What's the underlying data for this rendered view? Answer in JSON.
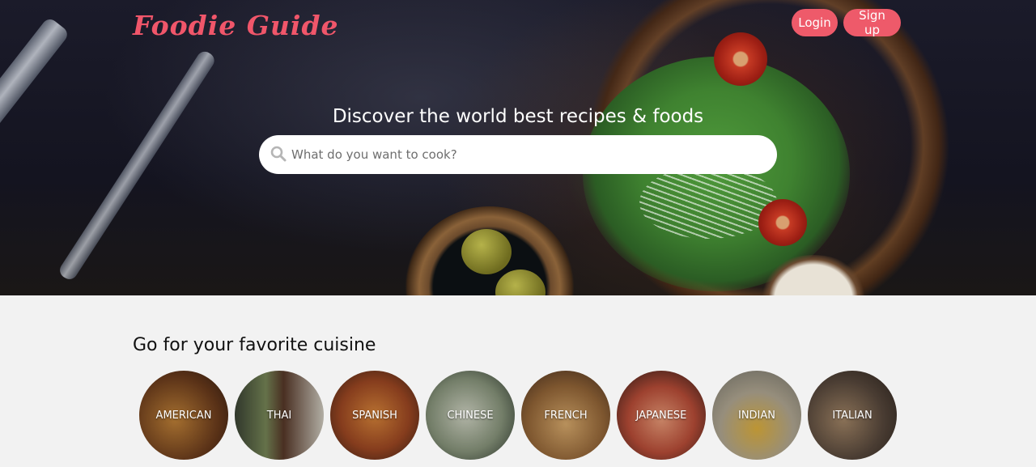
{
  "brand": {
    "logo": "Foodie Guide",
    "accent": "#ee5a6a"
  },
  "header": {
    "login_label": "Login",
    "signup_label": "Sign up"
  },
  "hero": {
    "tagline": "Discover the world best recipes & foods",
    "search": {
      "placeholder": "What do you want to cook?",
      "value": "",
      "icon": "search-icon"
    }
  },
  "cuisine_section": {
    "title": "Go for your favorite cuisine",
    "items": [
      {
        "label": "AMERICAN",
        "color": "#7a4a26"
      },
      {
        "label": "THAI",
        "color": "#4e5a3a"
      },
      {
        "label": "SPANISH",
        "color": "#8a4a28"
      },
      {
        "label": "CHINESE",
        "color": "#6f7a66"
      },
      {
        "label": "FRENCH",
        "color": "#9a6a3a"
      },
      {
        "label": "JAPANESE",
        "color": "#b45a48"
      },
      {
        "label": "INDIAN",
        "color": "#8c8a7c"
      },
      {
        "label": "ITALIAN",
        "color": "#5a4a3e"
      }
    ]
  }
}
